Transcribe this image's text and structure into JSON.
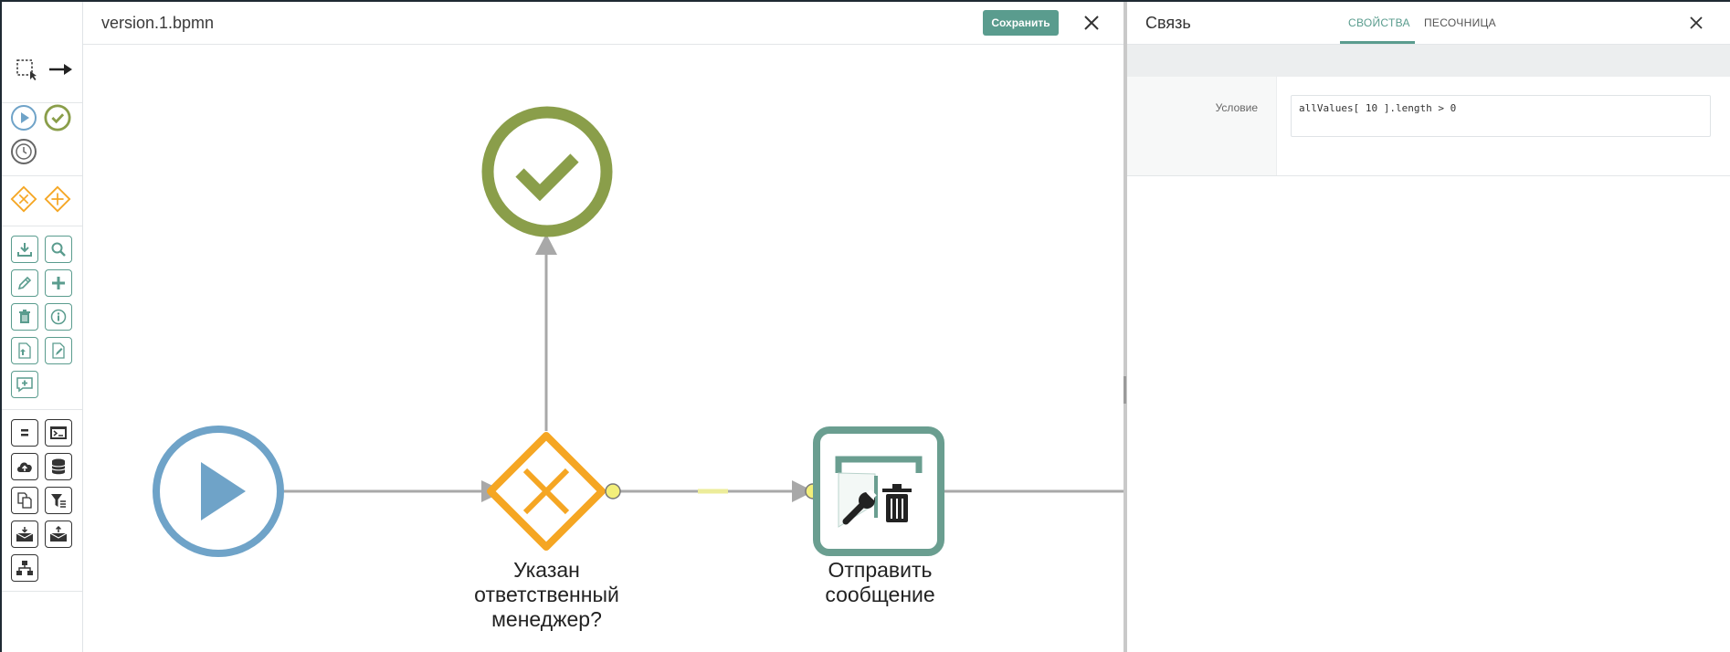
{
  "editor": {
    "file_name": "version.1.bpmn",
    "save_label": "Сохранить"
  },
  "diagram": {
    "gateway_label": "Указан\nответственный\nменеджер?",
    "task_label": "Отправить\nсообщение"
  },
  "panel": {
    "title": "Связь",
    "tabs": [
      {
        "label": "СВОЙСТВА",
        "active": true
      },
      {
        "label": "ПЕСОЧНИЦА",
        "active": false
      }
    ],
    "properties": [
      {
        "label": "Условие",
        "value": "allValues[ 10 ].length > 0"
      }
    ]
  },
  "colors": {
    "accent": "#5a9c8e",
    "start_event": "#6fa3c8",
    "end_event": "#8a9e4a",
    "gateway": "#f5a623",
    "flow": "#a8a8a8"
  },
  "toolbar_icons": [
    "lasso-select-icon",
    "connect-arrow-icon",
    "start-event-icon",
    "end-event-icon",
    "timer-event-icon",
    "exclusive-gateway-icon",
    "parallel-gateway-icon",
    "download-icon",
    "search-icon",
    "edit-icon",
    "add-icon",
    "delete-icon",
    "info-icon",
    "upload-doc-icon",
    "edit-doc-icon",
    "comment-icon",
    "variables-icon",
    "script-icon",
    "cloud-upload-icon",
    "database-icon",
    "copy-doc-icon",
    "filter-icon",
    "mail-in-icon",
    "mail-out-icon",
    "hierarchy-icon"
  ]
}
